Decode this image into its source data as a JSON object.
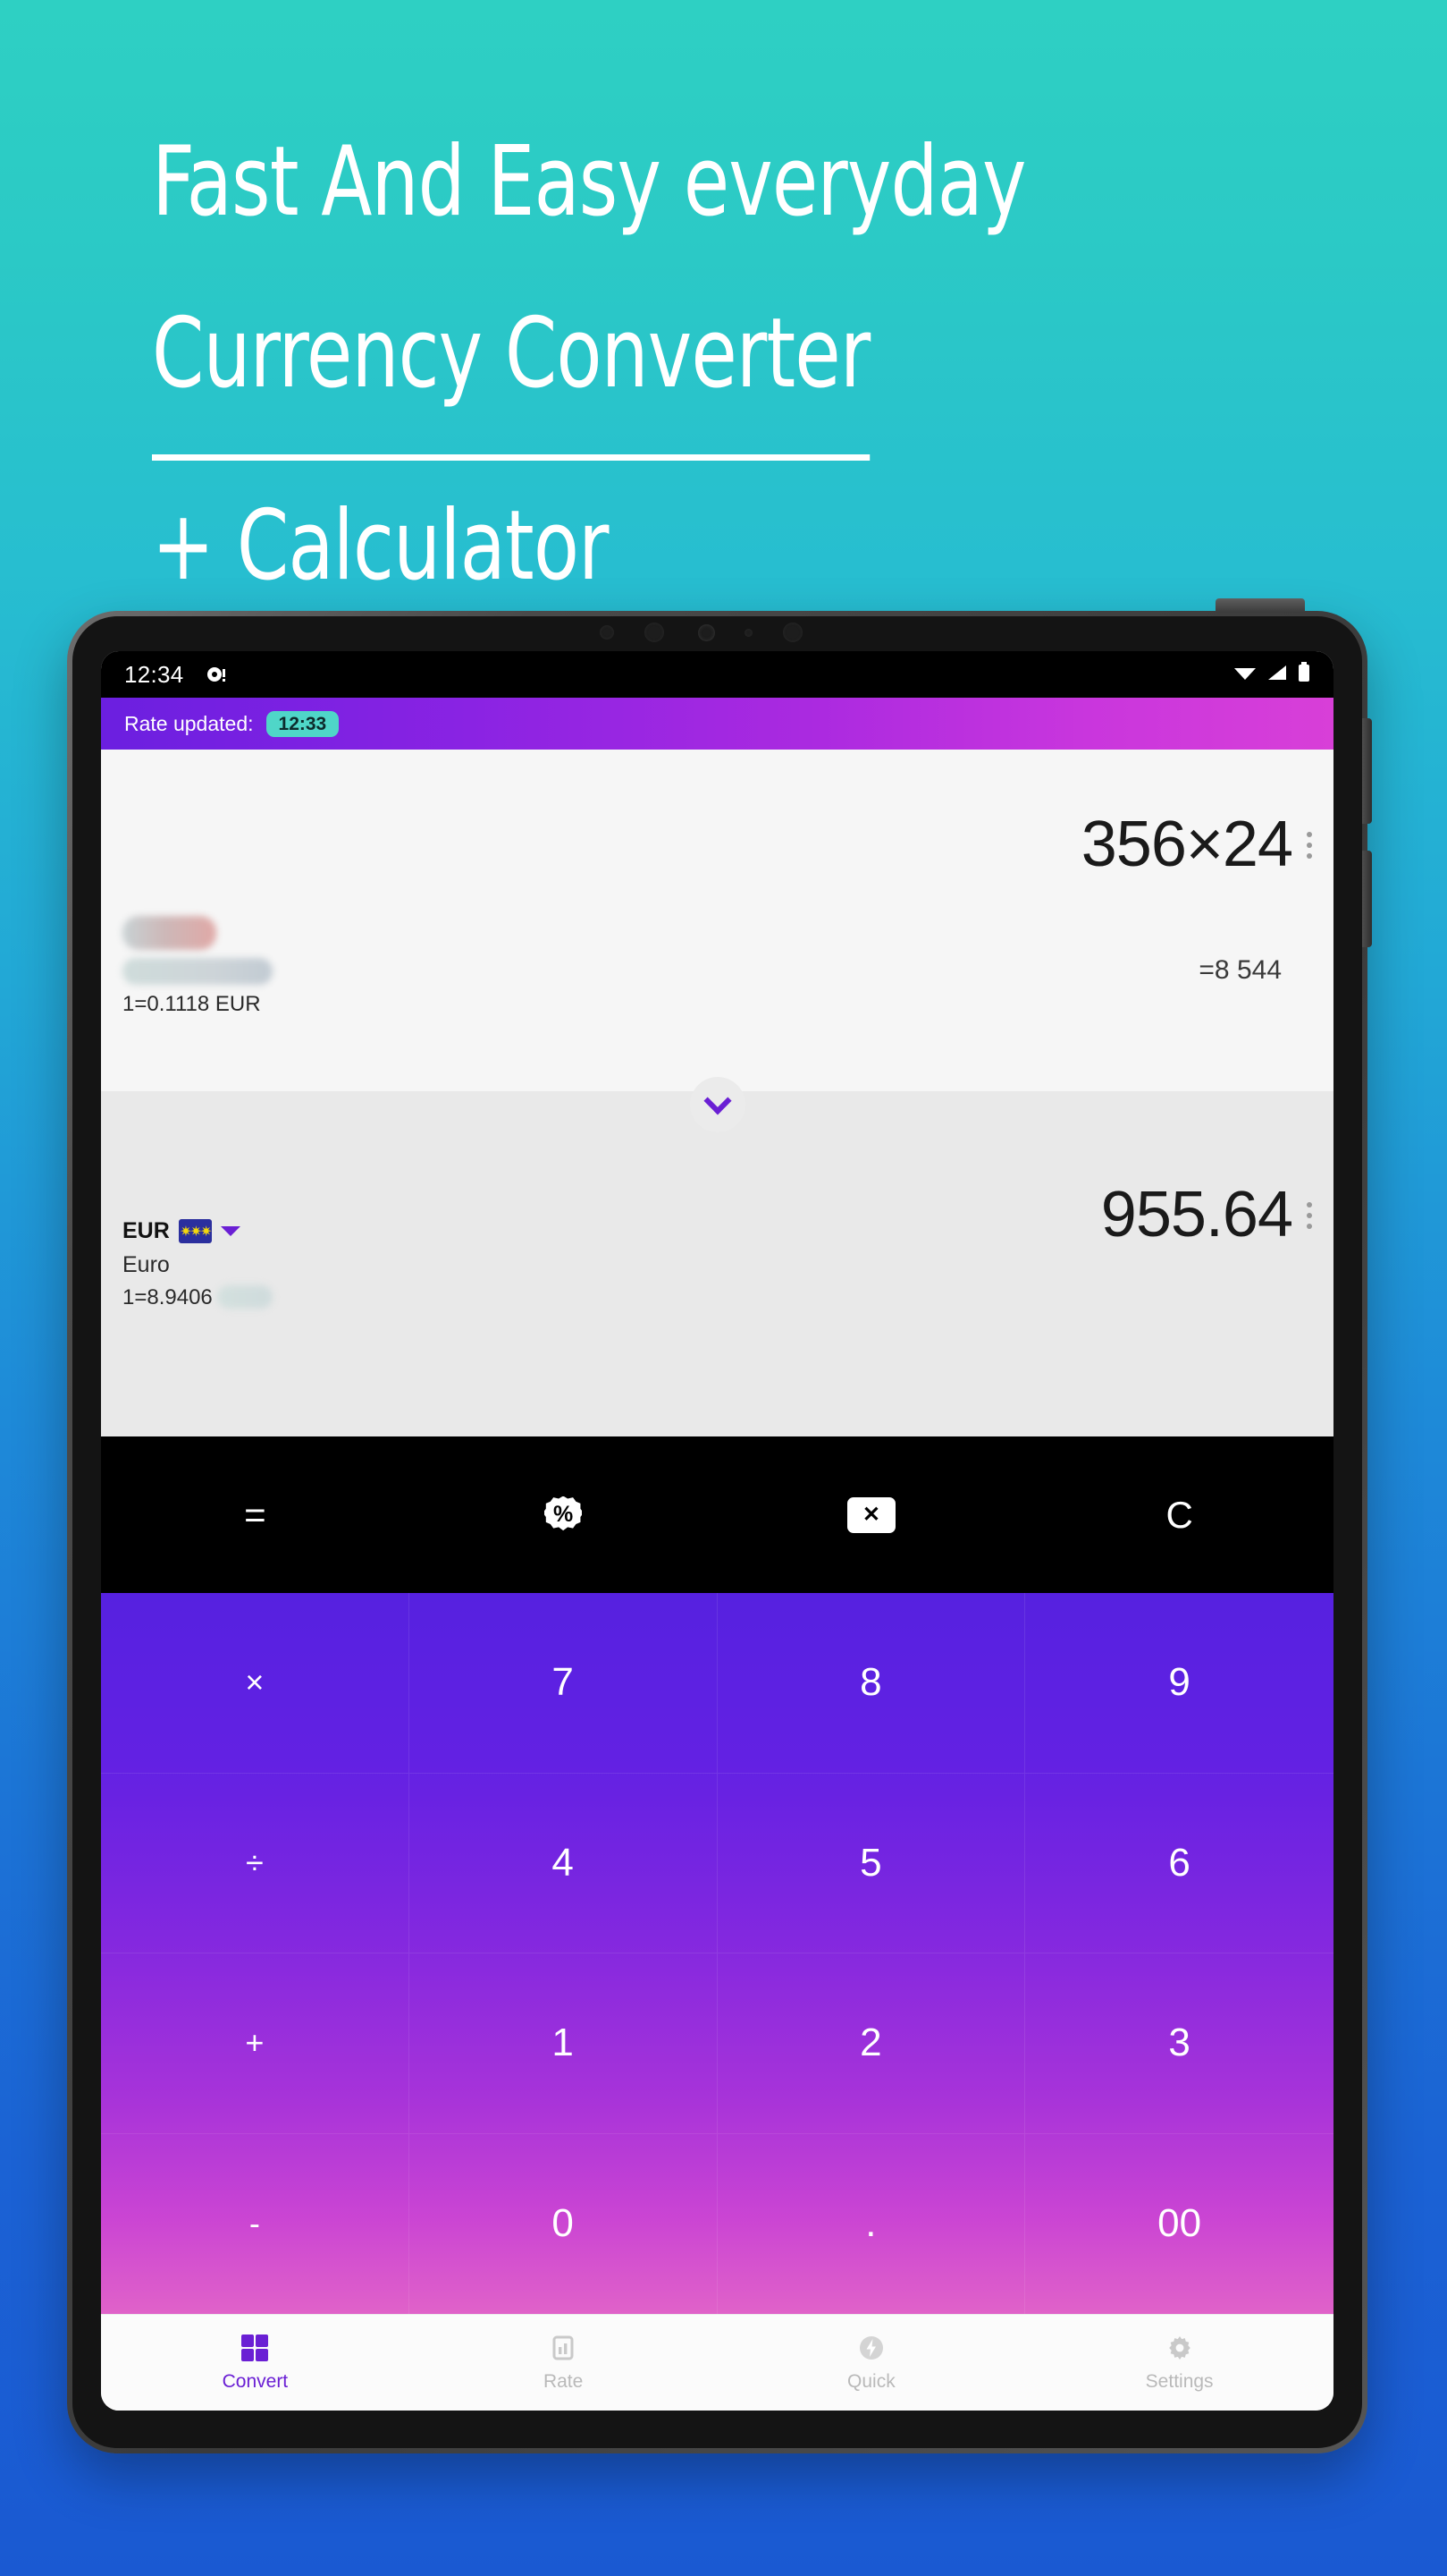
{
  "promo": {
    "line1": "Fast And Easy everyday",
    "line2": "Currency Converter",
    "line3": "+ Calculator",
    "background_top": "#2ed0c3",
    "background_bottom": "#1a59d2"
  },
  "statusbar": {
    "time": "12:34",
    "notification_icon": "notification-dot-icon",
    "wifi_icon": "wifi-icon",
    "signal_icon": "cellular-signal-icon",
    "battery_icon": "battery-icon"
  },
  "appbar": {
    "label": "Rate updated:",
    "badge_time": "12:33",
    "badge_color": "#4fd6c8",
    "gradient_from": "#6b1fe0",
    "gradient_to": "#d83fd8"
  },
  "converter": {
    "source": {
      "amount": "356×24",
      "result": "=8 544",
      "rate_line": "1=0.1118 EUR",
      "code_redacted": true,
      "name_redacted": true,
      "menu_icon": "kebab-menu-icon"
    },
    "swap_icon": "chevron-down-icon",
    "target": {
      "amount": "955.64",
      "code": "EUR",
      "flag_icon": "eu-flag-icon",
      "dropdown_icon": "caret-down-icon",
      "name": "Euro",
      "rate_prefix": "1=8.9406",
      "rate_suffix_redacted": true,
      "menu_icon": "kebab-menu-icon"
    }
  },
  "operator_bar": {
    "buttons": [
      {
        "label": "=",
        "name": "equals-button",
        "icon": ""
      },
      {
        "label": "%",
        "name": "percent-button",
        "icon": "percent-badge-icon"
      },
      {
        "label": "⌫",
        "name": "backspace-button",
        "icon": "backspace-icon"
      },
      {
        "label": "C",
        "name": "clear-button",
        "icon": ""
      }
    ]
  },
  "keypad": {
    "keys": [
      {
        "label": "×",
        "name": "key-multiply",
        "type": "op"
      },
      {
        "label": "7",
        "name": "key-7",
        "type": "num"
      },
      {
        "label": "8",
        "name": "key-8",
        "type": "num"
      },
      {
        "label": "9",
        "name": "key-9",
        "type": "num"
      },
      {
        "label": "÷",
        "name": "key-divide",
        "type": "op"
      },
      {
        "label": "4",
        "name": "key-4",
        "type": "num"
      },
      {
        "label": "5",
        "name": "key-5",
        "type": "num"
      },
      {
        "label": "6",
        "name": "key-6",
        "type": "num"
      },
      {
        "label": "+",
        "name": "key-plus",
        "type": "op"
      },
      {
        "label": "1",
        "name": "key-1",
        "type": "num"
      },
      {
        "label": "2",
        "name": "key-2",
        "type": "num"
      },
      {
        "label": "3",
        "name": "key-3",
        "type": "num"
      },
      {
        "label": "-",
        "name": "key-minus",
        "type": "op"
      },
      {
        "label": "0",
        "name": "key-0",
        "type": "num"
      },
      {
        "label": ".",
        "name": "key-decimal",
        "type": "num"
      },
      {
        "label": "00",
        "name": "key-double-zero",
        "type": "num"
      }
    ],
    "gradient_from": "#5621e0",
    "gradient_to": "#e062c9"
  },
  "bottomnav": {
    "active_color": "#6a1fd4",
    "inactive_color": "#b9b9b9",
    "items": [
      {
        "label": "Convert",
        "icon": "calculator-grid-icon",
        "active": true
      },
      {
        "label": "Rate",
        "icon": "bar-chart-icon",
        "active": false
      },
      {
        "label": "Quick",
        "icon": "flash-icon",
        "active": false
      },
      {
        "label": "Settings",
        "icon": "gear-icon",
        "active": false
      }
    ]
  }
}
